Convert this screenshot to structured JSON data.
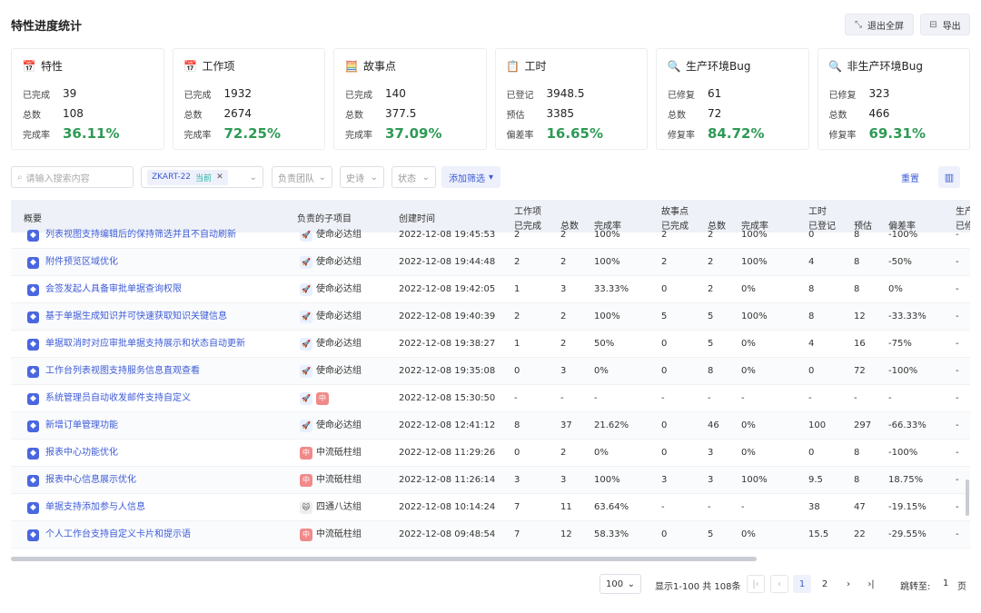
{
  "header": {
    "title": "特性进度统计",
    "exit_fullscreen": "退出全屏",
    "export": "导出"
  },
  "cards": [
    {
      "title": "特性",
      "icon": "calendar-icon",
      "rows": [
        {
          "label": "已完成",
          "value": "39"
        },
        {
          "label": "总数",
          "value": "108"
        }
      ],
      "rate_label": "完成率",
      "rate": "36.11%"
    },
    {
      "title": "工作项",
      "icon": "calendar-icon",
      "rows": [
        {
          "label": "已完成",
          "value": "1932"
        },
        {
          "label": "总数",
          "value": "2674"
        }
      ],
      "rate_label": "完成率",
      "rate": "72.25%"
    },
    {
      "title": "故事点",
      "icon": "abacus-icon",
      "rows": [
        {
          "label": "已完成",
          "value": "140"
        },
        {
          "label": "总数",
          "value": "377.5"
        }
      ],
      "rate_label": "完成率",
      "rate": "37.09%"
    },
    {
      "title": "工时",
      "icon": "clipboard-icon",
      "rows": [
        {
          "label": "已登记",
          "value": "3948.5"
        },
        {
          "label": "预估",
          "value": "3385"
        }
      ],
      "rate_label": "偏差率",
      "rate": "16.65%"
    },
    {
      "title": "生产环境Bug",
      "icon": "bug-search-icon",
      "rows": [
        {
          "label": "已修复",
          "value": "61"
        },
        {
          "label": "总数",
          "value": "72"
        }
      ],
      "rate_label": "修复率",
      "rate": "84.72%"
    },
    {
      "title": "非生产环境Bug",
      "icon": "bug-search-icon",
      "rows": [
        {
          "label": "已修复",
          "value": "323"
        },
        {
          "label": "总数",
          "value": "466"
        }
      ],
      "rate_label": "修复率",
      "rate": "69.31%"
    }
  ],
  "filters": {
    "search_placeholder": "请输入搜索内容",
    "version_tag": "ZKART-22",
    "version_current": "当前",
    "team": "负责团队",
    "epic": "史诗",
    "status": "状态",
    "add_filter": "添加筛选",
    "reset": "重置"
  },
  "table": {
    "headers": {
      "summary": "概要",
      "team": "负责的子项目",
      "created": "创建时间",
      "work_items": "工作项",
      "story_points": "故事点",
      "hours": "工时",
      "prod": "生产",
      "done": "已完成",
      "total": "总数",
      "rate": "完成率",
      "logged": "已登记",
      "estimate": "预估",
      "deviation": "偏差率",
      "prod_sub": "已修"
    },
    "rows": [
      {
        "summary": "列表视图支持编辑后的保持筛选并且不自动刷新",
        "team_icon": "rocket",
        "team_badge": "",
        "team": "使命必达组",
        "created": "2022-12-08 19:45:53",
        "w_done": "2",
        "w_total": "2",
        "w_rate": "100%",
        "s_done": "2",
        "s_total": "2",
        "s_rate": "100%",
        "h_logged": "0",
        "h_est": "8",
        "h_dev": "-100%",
        "extra": "-"
      },
      {
        "summary": "附件预览区域优化",
        "team_icon": "rocket",
        "team_badge": "",
        "team": "使命必达组",
        "created": "2022-12-08 19:44:48",
        "w_done": "2",
        "w_total": "2",
        "w_rate": "100%",
        "s_done": "2",
        "s_total": "2",
        "s_rate": "100%",
        "h_logged": "4",
        "h_est": "8",
        "h_dev": "-50%",
        "extra": "-"
      },
      {
        "summary": "会签发起人具备审批单据查询权限",
        "team_icon": "rocket",
        "team_badge": "",
        "team": "使命必达组",
        "created": "2022-12-08 19:42:05",
        "w_done": "1",
        "w_total": "3",
        "w_rate": "33.33%",
        "s_done": "0",
        "s_total": "2",
        "s_rate": "0%",
        "h_logged": "8",
        "h_est": "8",
        "h_dev": "0%",
        "extra": "-"
      },
      {
        "summary": "基于单据生成知识并可快速获取知识关键信息",
        "team_icon": "rocket",
        "team_badge": "",
        "team": "使命必达组",
        "created": "2022-12-08 19:40:39",
        "w_done": "2",
        "w_total": "2",
        "w_rate": "100%",
        "s_done": "5",
        "s_total": "5",
        "s_rate": "100%",
        "h_logged": "8",
        "h_est": "12",
        "h_dev": "-33.33%",
        "extra": "-"
      },
      {
        "summary": "单据取消时对应审批单据支持展示和状态自动更新",
        "team_icon": "rocket",
        "team_badge": "",
        "team": "使命必达组",
        "created": "2022-12-08 19:38:27",
        "w_done": "1",
        "w_total": "2",
        "w_rate": "50%",
        "s_done": "0",
        "s_total": "5",
        "s_rate": "0%",
        "h_logged": "4",
        "h_est": "16",
        "h_dev": "-75%",
        "extra": "-"
      },
      {
        "summary": "工作台列表视图支持服务信息直观查看",
        "team_icon": "rocket",
        "team_badge": "",
        "team": "使命必达组",
        "created": "2022-12-08 19:35:08",
        "w_done": "0",
        "w_total": "3",
        "w_rate": "0%",
        "s_done": "0",
        "s_total": "8",
        "s_rate": "0%",
        "h_logged": "0",
        "h_est": "72",
        "h_dev": "-100%",
        "extra": "-"
      },
      {
        "summary": "系统管理员自动收发邮件支持自定义",
        "team_icon": "rocket",
        "team_badge": "中",
        "team": "",
        "created": "2022-12-08 15:30:50",
        "w_done": "-",
        "w_total": "-",
        "w_rate": "-",
        "s_done": "-",
        "s_total": "-",
        "s_rate": "-",
        "h_logged": "-",
        "h_est": "-",
        "h_dev": "-",
        "extra": "-"
      },
      {
        "summary": "新增订单管理功能",
        "team_icon": "rocket",
        "team_badge": "",
        "team": "使命必达组",
        "created": "2022-12-08 12:41:12",
        "w_done": "8",
        "w_total": "37",
        "w_rate": "21.62%",
        "s_done": "0",
        "s_total": "46",
        "s_rate": "0%",
        "h_logged": "100",
        "h_est": "297",
        "h_dev": "-66.33%",
        "extra": "-"
      },
      {
        "summary": "报表中心功能优化",
        "team_icon": "red",
        "team_badge": "中",
        "team": "中流砥柱组",
        "created": "2022-12-08 11:29:26",
        "w_done": "0",
        "w_total": "2",
        "w_rate": "0%",
        "s_done": "0",
        "s_total": "3",
        "s_rate": "0%",
        "h_logged": "0",
        "h_est": "8",
        "h_dev": "-100%",
        "extra": "-"
      },
      {
        "summary": "报表中心信息展示优化",
        "team_icon": "red",
        "team_badge": "中",
        "team": "中流砥柱组",
        "created": "2022-12-08 11:26:14",
        "w_done": "3",
        "w_total": "3",
        "w_rate": "100%",
        "s_done": "3",
        "s_total": "3",
        "s_rate": "100%",
        "h_logged": "9.5",
        "h_est": "8",
        "h_dev": "18.75%",
        "extra": "-"
      },
      {
        "summary": "单据支持添加参与人信息",
        "team_icon": "cat",
        "team_badge": "",
        "team": "四通八达组",
        "created": "2022-12-08 10:14:24",
        "w_done": "7",
        "w_total": "11",
        "w_rate": "63.64%",
        "s_done": "-",
        "s_total": "-",
        "s_rate": "-",
        "h_logged": "38",
        "h_est": "47",
        "h_dev": "-19.15%",
        "extra": "-"
      },
      {
        "summary": "个人工作台支持自定义卡片和提示语",
        "team_icon": "red",
        "team_badge": "中",
        "team": "中流砥柱组",
        "created": "2022-12-08 09:48:54",
        "w_done": "7",
        "w_total": "12",
        "w_rate": "58.33%",
        "s_done": "0",
        "s_total": "5",
        "s_rate": "0%",
        "h_logged": "15.5",
        "h_est": "22",
        "h_dev": "-29.55%",
        "extra": "-"
      }
    ]
  },
  "pagination": {
    "page_size": "100",
    "info": "显示1-100 共 108条",
    "pages": [
      "1",
      "2"
    ],
    "jump_label": "跳转至:",
    "jump_value": "1",
    "unit": "页"
  }
}
